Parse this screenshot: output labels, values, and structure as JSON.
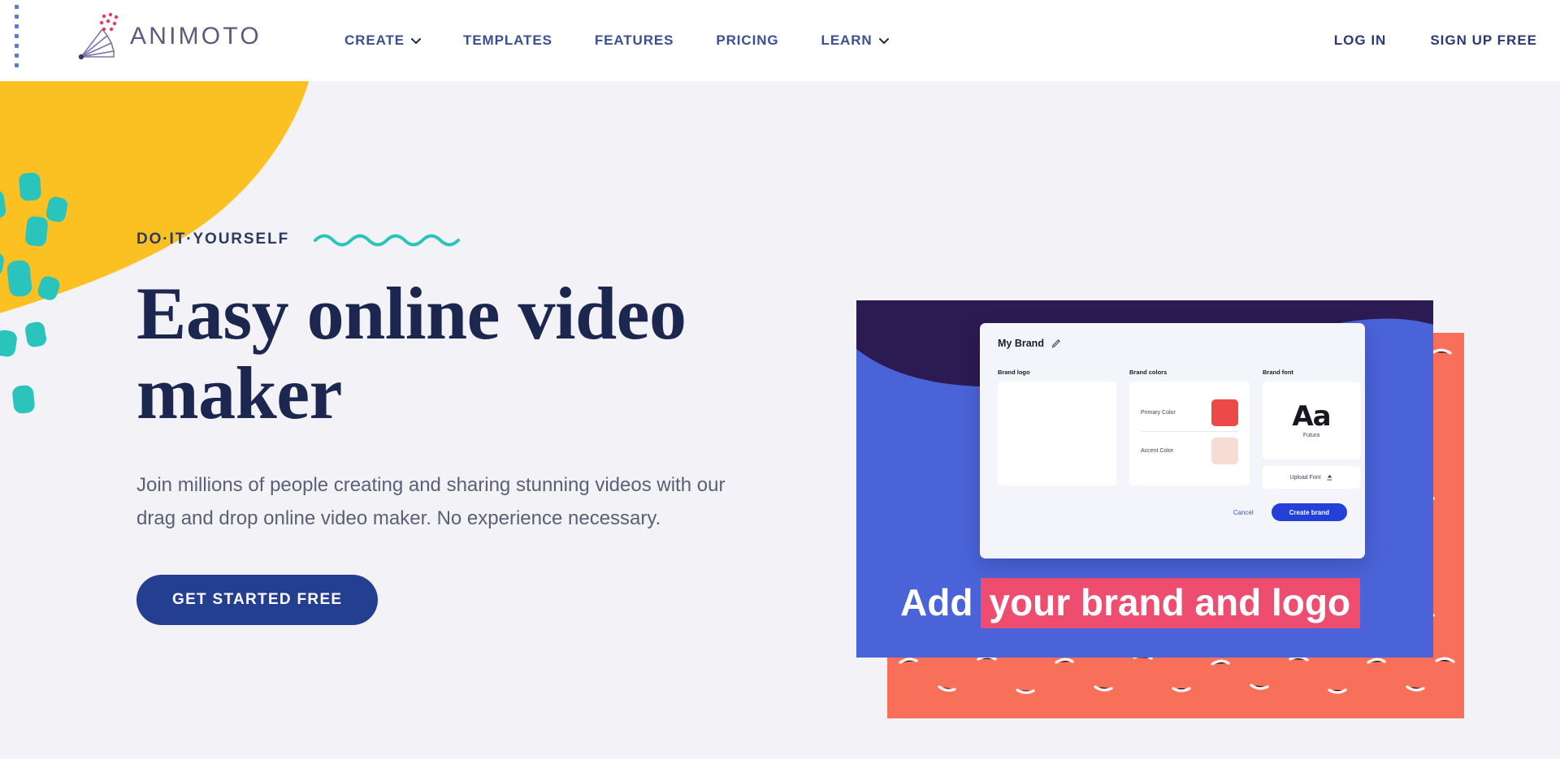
{
  "brand": {
    "name": "ANIMOTO",
    "logo_icon": "animoto-fan-logo",
    "colors": {
      "nav_text": "#3b4f93",
      "headline": "#1c2750",
      "cta_bg": "#243f8f",
      "yellow": "#fbc022",
      "teal": "#2bc4bd",
      "coral": "#f9705a",
      "card_blue": "#4a63d8",
      "dark_purple": "#2c1a52",
      "highlight_pink": "#ef4d6f",
      "page_bg": "#f2f2f7"
    }
  },
  "header": {
    "nav_items": [
      {
        "label": "CREATE",
        "has_dropdown": true,
        "icon": "chevron-down-icon"
      },
      {
        "label": "TEMPLATES",
        "has_dropdown": false,
        "icon": ""
      },
      {
        "label": "FEATURES",
        "has_dropdown": false,
        "icon": ""
      },
      {
        "label": "PRICING",
        "has_dropdown": false,
        "icon": ""
      },
      {
        "label": "LEARN",
        "has_dropdown": true,
        "icon": "chevron-down-icon"
      }
    ],
    "account_items": [
      {
        "label": "LOG IN"
      },
      {
        "label": "SIGN UP FREE"
      }
    ]
  },
  "hero": {
    "eyebrow": "DO·IT·YOURSELF",
    "eyebrow_decoration": "teal-squiggle",
    "headline": "Easy online video maker",
    "subtext": "Join millions of people creating and sharing stunning videos with our drag and drop online video maker. No experience necessary.",
    "cta_label": "GET STARTED FREE"
  },
  "media": {
    "caption_plain": "Add",
    "caption_highlight": "your brand and logo",
    "modal": {
      "title": "My Brand",
      "edit_icon": "pencil-icon",
      "logo_label": "Brand logo",
      "colors_label": "Brand colors",
      "font_label": "Brand font",
      "colors": [
        {
          "name": "Primary Color",
          "hex": "#ec4a48"
        },
        {
          "name": "Accent Color",
          "hex": "#f6ddd4"
        }
      ],
      "font_sample": "Aa",
      "font_name": "Futura",
      "upload_label": "Upload Font",
      "upload_icon": "upload-icon",
      "cancel_label": "Cancel",
      "create_label": "Create brand"
    }
  }
}
